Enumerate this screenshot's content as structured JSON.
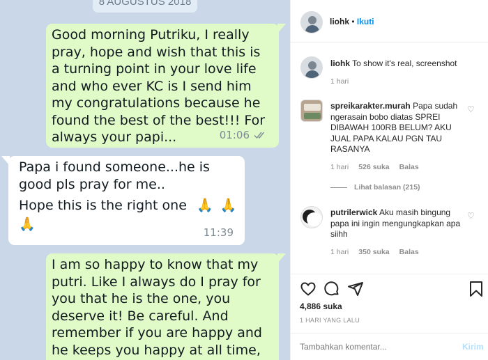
{
  "chat": {
    "date": "8 AUGUSTUS 2018",
    "messages": [
      {
        "text": "Good morning Putriku,  I really pray, hope and wish that this is a turning point in your love life and who ever KC is I send him my congratulations because he found the best of the best!!! For always your papi...",
        "time": "01:06"
      },
      {
        "text": "Papa i found someone...he is good pls pray for me..",
        "text2": "Hope this is the right one",
        "emoji": "🙏",
        "time": "11:39"
      },
      {
        "text": "I am so happy to know that my putri. Like I always do I pray for you that he is the one,  you deserve it! Be careful. And remember  if you are happy and he keeps you happy at all time, than"
      }
    ]
  },
  "instagram": {
    "header": {
      "username": "liohk",
      "follow": "Ikuti"
    },
    "caption": {
      "username": "liohk",
      "text": "To show it's real, screenshot",
      "time": "1 hari"
    },
    "comments": [
      {
        "username": "spreikarakter.murah",
        "text": "Papa sudah ngerasain bobo diatas SPREI DIBAWAH 100RB BELUM? AKU JUAL PAPA KALAU PGN TAU RASANYA",
        "time": "1 hari",
        "likes": "526 suka",
        "reply": "Balas",
        "view_replies": "Lihat balasan (215)"
      },
      {
        "username": "putrilerwick",
        "text": "Aku masih bingung papa ini ingin mengungkapkan apa siihh",
        "time": "1 hari",
        "likes": "350 suka",
        "reply": "Balas"
      }
    ],
    "likes": "4,886 suka",
    "post_time": "1 HARI YANG LALU",
    "comment_placeholder": "Tambahkan komentar...",
    "post_button": "Kirim",
    "colors": {
      "link": "#0095f6",
      "bubble_out": "#e1fbc8",
      "chat_bg": "#c9d7e8"
    }
  }
}
